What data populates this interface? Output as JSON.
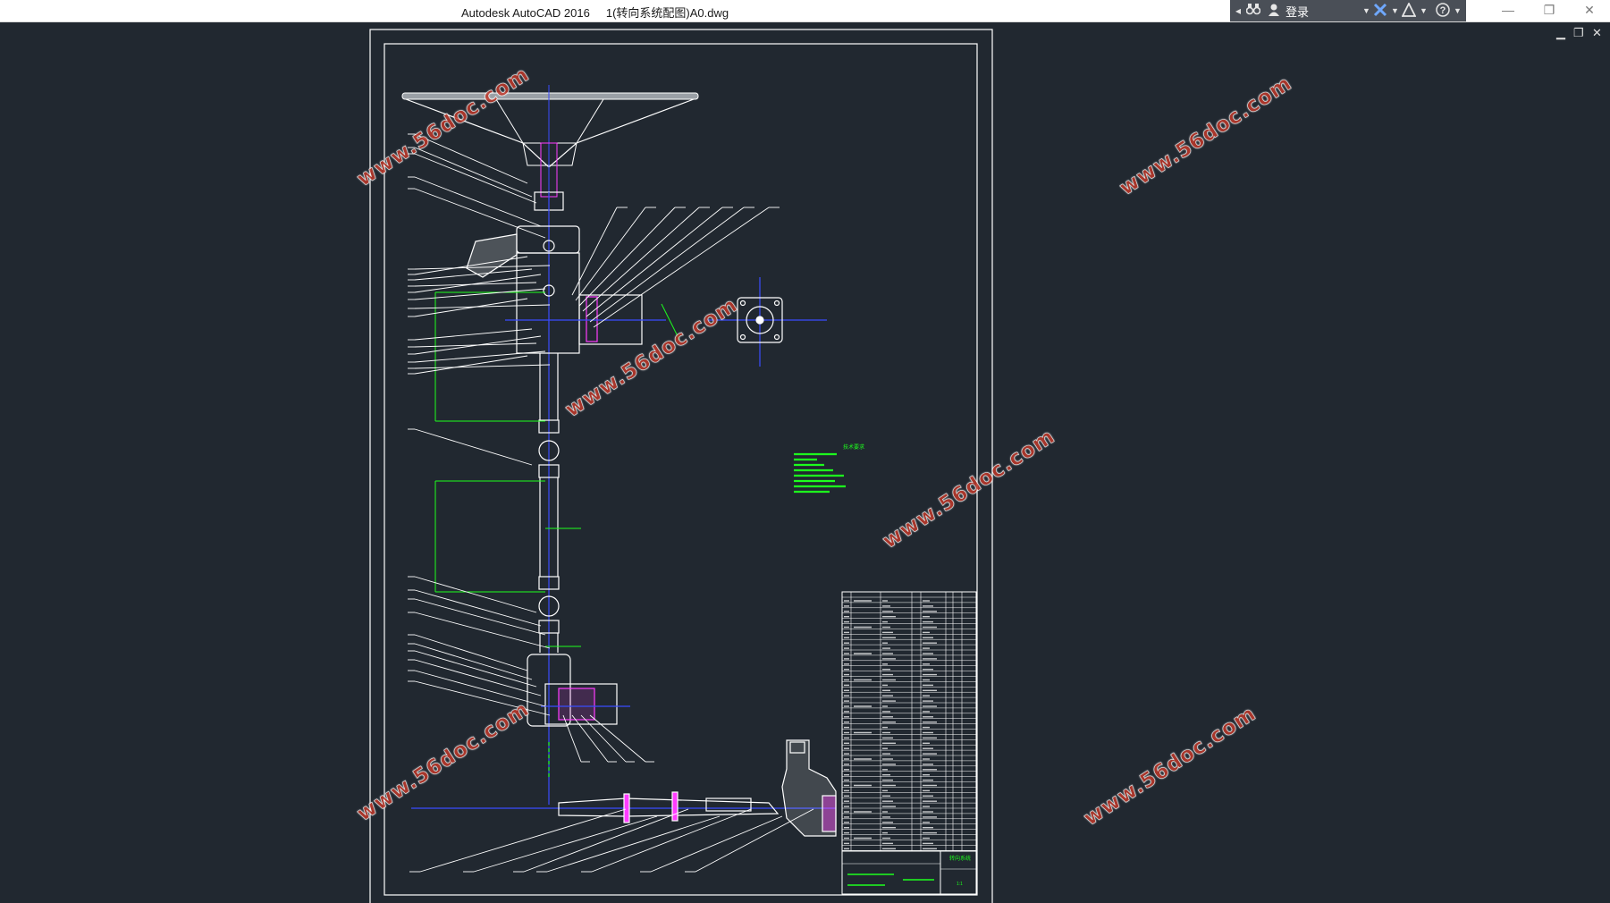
{
  "window": {
    "title": "Autodesk AutoCAD 2016     1(转向系统配图)A0.dwg",
    "login_label": "登录",
    "minimize": "—",
    "restore": "❐",
    "close": "✕"
  },
  "doc_controls": {
    "minimize": "▁",
    "restore": "❐",
    "close": "✕"
  },
  "help_bar_icons": [
    "binoculars-icon",
    "user-icon",
    "exchange-x-icon",
    "autodesk-a-icon",
    "help-icon"
  ],
  "drawing": {
    "tech_requirements_title": "技术要求",
    "tech_requirement_lines": 8,
    "title_block_name": "转向系统",
    "title_block_scale": "1:1"
  },
  "watermark": "www.56doc.com",
  "colors": {
    "background": "#212830",
    "cad_white": "#ffffff",
    "cad_green": "#1dff1d",
    "cad_blue": "#3a4cff",
    "cad_magenta": "#ff3cff",
    "watermark": "#c0392b"
  }
}
